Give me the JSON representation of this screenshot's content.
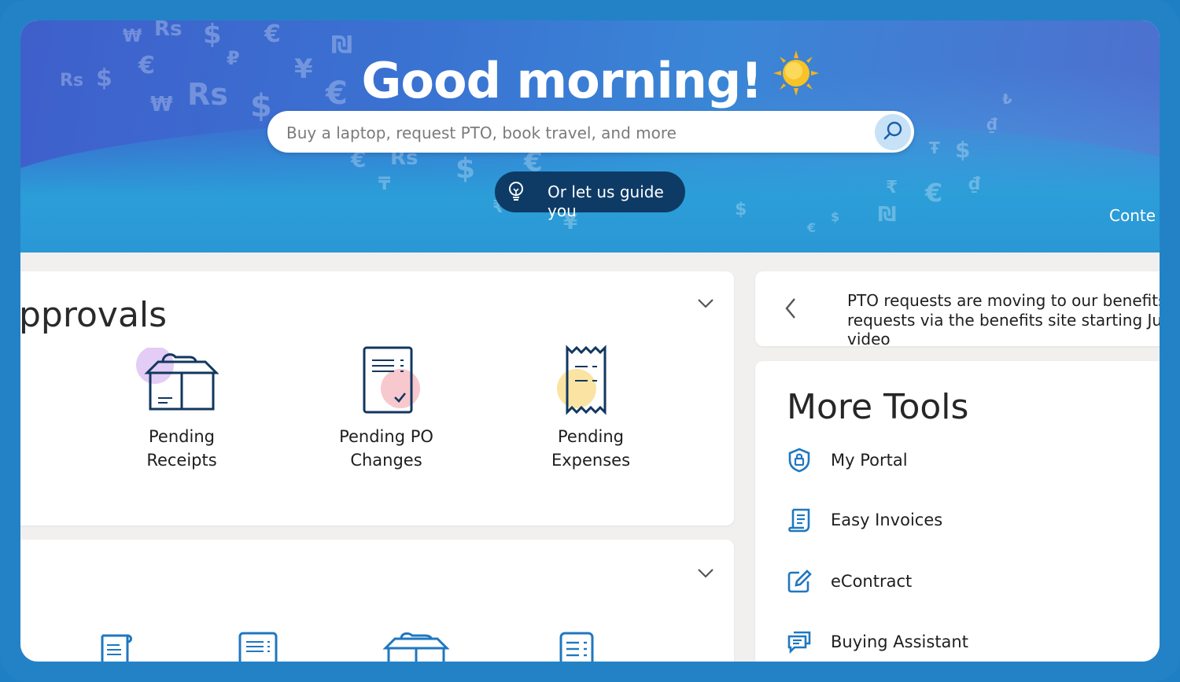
{
  "hero": {
    "greeting": "Good morning!",
    "search_placeholder": "Buy a laptop, request PTO, book travel, and more",
    "guide_label": "Or let us guide you",
    "cut_link": "Conte"
  },
  "approvals": {
    "title": "pprovals",
    "tiles": [
      {
        "line1": "Pending",
        "line2": "Receipts",
        "icon": "open-box-icon"
      },
      {
        "line1": "Pending PO",
        "line2": "Changes",
        "icon": "document-check-icon"
      },
      {
        "line1": "Pending",
        "line2": "Expenses",
        "icon": "receipt-icon"
      }
    ]
  },
  "notice": {
    "line1": "PTO requests are moving to our benefits",
    "line2": "requests via the benefits site starting Ju",
    "line3": "video"
  },
  "tools": {
    "title": "More Tools",
    "items": [
      {
        "label": "My Portal",
        "icon": "shield-lock-icon"
      },
      {
        "label": "Easy Invoices",
        "icon": "invoice-icon"
      },
      {
        "label": "eContract",
        "icon": "edit-icon"
      },
      {
        "label": "Buying Assistant",
        "icon": "chat-icon"
      }
    ]
  },
  "colors": {
    "frame": "#2382c6",
    "hero_blue": "#3a73d2",
    "guide_button": "#0e3b66",
    "icon_blue": "#1f77c0",
    "icon_navy": "#12375f"
  }
}
